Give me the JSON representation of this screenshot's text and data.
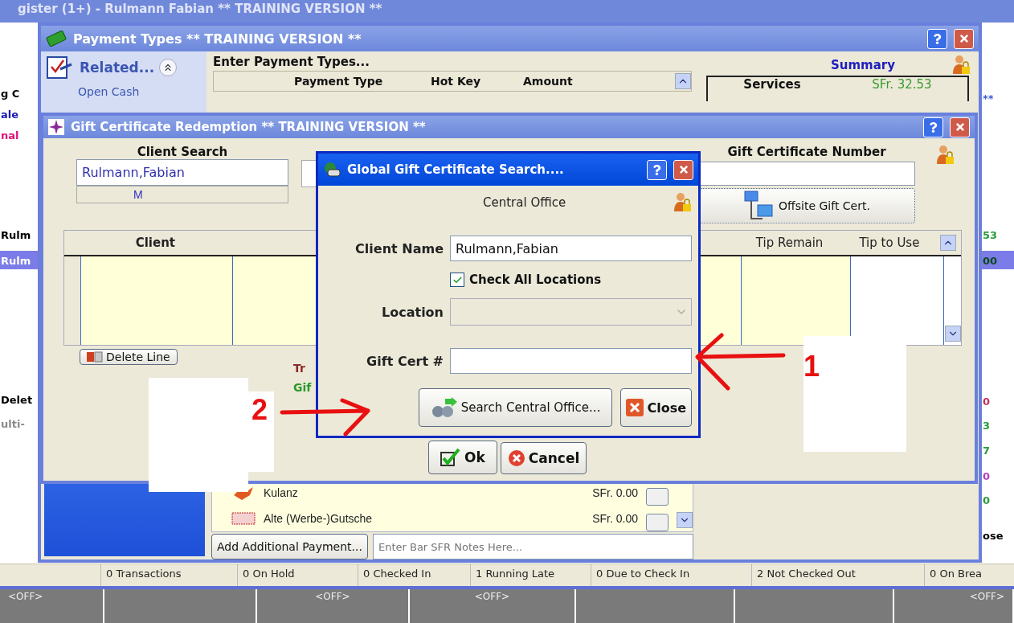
{
  "register": {
    "title": "gister (1+) - Rulmann Fabian ** TRAINING VERSION **",
    "left_fragments": [
      {
        "text": "g C",
        "color": "#000000",
        "selected": false
      },
      {
        "text": "ale",
        "color": "#1a1ab0",
        "selected": false
      },
      {
        "text": "nal",
        "color": "#e0107a",
        "selected": false
      },
      {
        "text": "Rulm",
        "color": "#000000",
        "selected": false
      },
      {
        "text": "Rulm",
        "color": "#ffffff",
        "selected": true
      },
      {
        "text": "Delet",
        "color": "#000000",
        "selected": false
      },
      {
        "text": "ulti-",
        "color": "#8a8a8a",
        "selected": false
      }
    ],
    "right_fragments": [
      {
        "text": "**",
        "color": "#3a5ad0",
        "selected": false
      },
      {
        "text": "53",
        "color": "#2a9a3a",
        "selected": false
      },
      {
        "text": "00",
        "color": "#0a4a1a",
        "selected": true
      },
      {
        "text": "0",
        "color": "#c0305a",
        "selected": false
      },
      {
        "text": "3",
        "color": "#2a9a3a",
        "selected": false
      },
      {
        "text": "7",
        "color": "#2a9a3a",
        "selected": false
      },
      {
        "text": "0",
        "color": "#b040c0",
        "selected": false
      },
      {
        "text": "0",
        "color": "#2a9a3a",
        "selected": false
      },
      {
        "text": "ose",
        "color": "#000000",
        "selected": false
      }
    ],
    "status_bar": [
      "0 Transactions",
      "0 On Hold",
      "0 Checked In",
      "1 Running Late",
      "0 Due to Check In",
      "2 Not Checked Out",
      "0 On Brea"
    ],
    "keypad": [
      {
        "kind": "off",
        "label": "<OFF>"
      },
      {
        "kind": "empty"
      },
      {
        "kind": "off",
        "label": "<OFF>"
      },
      {
        "kind": "off",
        "label": "<OFF>"
      },
      {
        "kind": "empty"
      },
      {
        "kind": "empty"
      },
      {
        "kind": "off",
        "label": "<OFF>"
      }
    ]
  },
  "payment_window": {
    "title": "Payment Types ** TRAINING VERSION **",
    "related": {
      "label": "Related...",
      "expanded": true,
      "items": [
        "Open Cash"
      ]
    },
    "heading": "Enter Payment Types...",
    "columns": [
      "Payment Type",
      "Hot Key",
      "Amount"
    ],
    "summary": {
      "title": "Summary",
      "rows": [
        {
          "label": "Services",
          "value": "SFr. 32.53"
        }
      ]
    },
    "rows": [
      {
        "name": "Kulanz",
        "amount": "SFr. 0.00"
      },
      {
        "name": "Alte (Werbe-)Gutsche",
        "amount": "SFr. 0.00"
      }
    ],
    "add_button": "Add Additional Payment...",
    "notes": {
      "placeholder": "Enter Bar SFR Notes Here..."
    }
  },
  "gift_window": {
    "title": "Gift Certificate Redemption ** TRAINING VERSION **",
    "client_search": {
      "label": "Client Search",
      "value": "Rulmann,Fabian",
      "gender": "M"
    },
    "number": {
      "label": "Gift Certificate Number"
    },
    "offsite_button": "Offsite Gift Cert.",
    "columns_left": [
      "Client"
    ],
    "columns_right": [
      "Tip Remain",
      "Tip to Use"
    ],
    "delete_button": "Delete Line",
    "notes": [
      {
        "text": "Tr",
        "color": "#8a2a2a"
      },
      {
        "text": "Gif",
        "color": "#2a9a2a"
      }
    ],
    "ok_button": "Ok",
    "cancel_button": "Cancel"
  },
  "search_dialog": {
    "title": "Global Gift Certificate Search....",
    "office": "Central Office",
    "client_name": {
      "label": "Client Name",
      "value": "Rulmann,Fabian"
    },
    "check_all": {
      "label": "Check All Locations",
      "checked": true
    },
    "location": {
      "label": "Location",
      "disabled": true
    },
    "gift_cert": {
      "label": "Gift Cert #"
    },
    "search_button": "Search Central Office...",
    "close_button": "Close"
  },
  "annotations": [
    {
      "label": "1"
    },
    {
      "label": "2"
    }
  ]
}
